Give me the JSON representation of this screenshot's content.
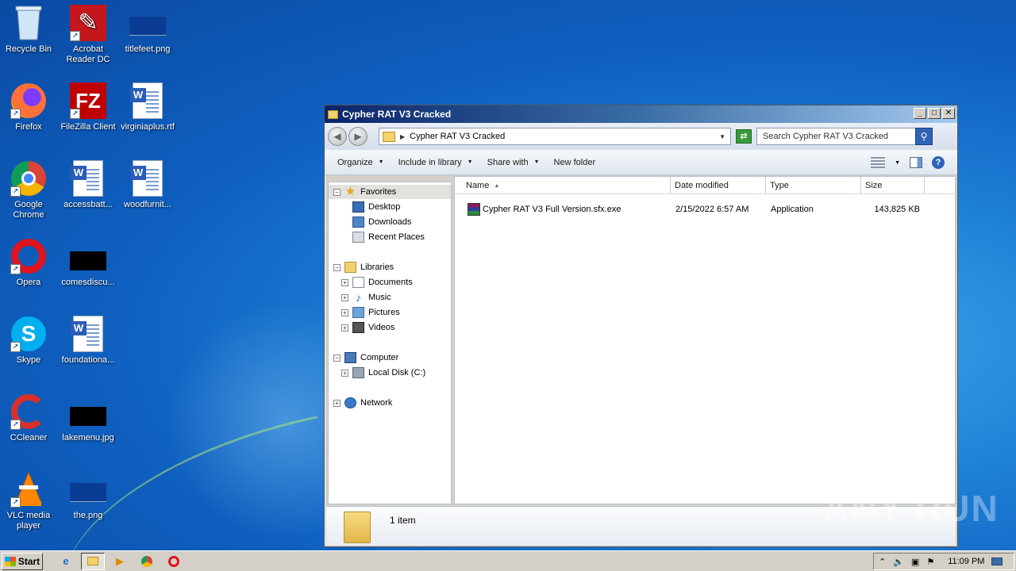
{
  "desktop": {
    "icons": [
      {
        "label": "Recycle Bin"
      },
      {
        "label": "Acrobat Reader DC"
      },
      {
        "label": "titlefeet.png"
      },
      {
        "label": "Firefox"
      },
      {
        "label": "FileZilla Client"
      },
      {
        "label": "virginiaplus.rtf"
      },
      {
        "label": "Google Chrome"
      },
      {
        "label": "accessbatt..."
      },
      {
        "label": "woodfurnit..."
      },
      {
        "label": "Opera"
      },
      {
        "label": "comesdiscu..."
      },
      {
        "label": "Skype"
      },
      {
        "label": "foundationa..."
      },
      {
        "label": "CCleaner"
      },
      {
        "label": "lakemenu.jpg"
      },
      {
        "label": "VLC media player"
      },
      {
        "label": "the.png"
      }
    ]
  },
  "window": {
    "title": "Cypher RAT V3 Cracked",
    "address": "Cypher RAT V3 Cracked",
    "search_placeholder": "Search Cypher RAT V3 Cracked",
    "toolbar": {
      "organize": "Organize",
      "include": "Include in library",
      "share": "Share with",
      "newfolder": "New folder"
    },
    "nav": {
      "favorites": "Favorites",
      "desktop": "Desktop",
      "downloads": "Downloads",
      "recent": "Recent Places",
      "libraries": "Libraries",
      "documents": "Documents",
      "music": "Music",
      "pictures": "Pictures",
      "videos": "Videos",
      "computer": "Computer",
      "localdisk": "Local Disk (C:)",
      "network": "Network"
    },
    "columns": {
      "name": "Name",
      "date": "Date modified",
      "type": "Type",
      "size": "Size"
    },
    "files": [
      {
        "name": "Cypher RAT V3 Full Version.sfx.exe",
        "date": "2/15/2022 6:57 AM",
        "type": "Application",
        "size": "143,825 KB"
      }
    ],
    "details_count": "1 item"
  },
  "taskbar": {
    "start": "Start",
    "clock": "11:09 PM"
  },
  "watermark": "ANY RUN"
}
